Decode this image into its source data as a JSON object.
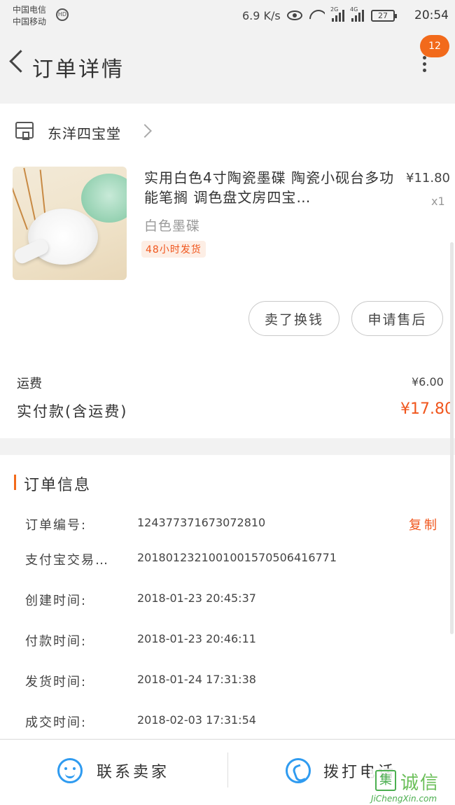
{
  "status_bar": {
    "carrier1": "中国电信",
    "carrier2": "中国移动",
    "hd_badge": "HD",
    "net_speed": "6.9 K/s",
    "signal1_type": "2G",
    "signal2_type": "4G",
    "battery": "27",
    "time": "20:54"
  },
  "header": {
    "title": "订单详情",
    "message_count": "12",
    "back_icon": "chevron-left-icon",
    "more_icon": "more-vertical-icon"
  },
  "shop": {
    "name": "东洋四宝堂",
    "icon": "store-icon"
  },
  "product": {
    "title": "实用白色4寸陶瓷墨碟 陶瓷小砚台多功能笔搁 调色盘文房四宝…",
    "price": "¥11.80",
    "quantity": "x1",
    "variant": "白色墨碟",
    "shipping_tag": "48小时发货"
  },
  "actions": {
    "resell": "卖了换钱",
    "after_sale": "申请售后"
  },
  "fees": {
    "shipping_label": "运费",
    "shipping_value": "¥6.00",
    "paid_label": "实付款(含运费)",
    "paid_value": "¥17.80"
  },
  "order_info": {
    "title": "订单信息",
    "copy_label": "复制",
    "rows": [
      {
        "label": "订单编号:",
        "value": "124377371673072810"
      },
      {
        "label": "支付宝交易…",
        "value": "2018012321001001570506416771"
      },
      {
        "label": "创建时间:",
        "value": "2018-01-23 20:45:37"
      },
      {
        "label": "付款时间:",
        "value": "2018-01-23 20:46:11"
      },
      {
        "label": "发货时间:",
        "value": "2018-01-24 17:31:38"
      },
      {
        "label": "成交时间:",
        "value": "2018-02-03 17:31:54"
      }
    ]
  },
  "bottom_bar": {
    "contact_seller": "联系卖家",
    "call": "拨打电话"
  },
  "watermark": {
    "logo_char": "集",
    "text": "诚信",
    "url": "JiChengXin.com"
  },
  "colors": {
    "accent": "#f26a1b",
    "price_orange": "#f0561d",
    "icon_blue": "#2f9bf0"
  }
}
